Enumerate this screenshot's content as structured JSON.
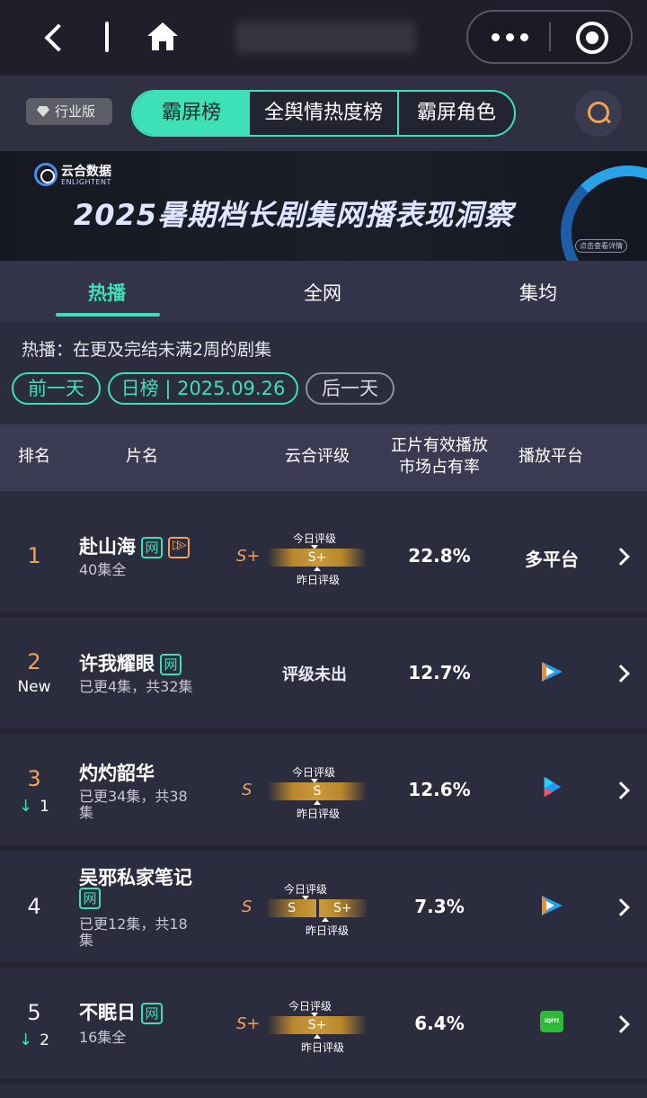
{
  "header": {
    "edition_label": "行业版",
    "segments": [
      "霸屏榜",
      "全舆情热度榜",
      "霸屏角色"
    ]
  },
  "banner": {
    "brand_cn": "云合数据",
    "brand_en": "ENLIGHTENT",
    "title": "2025暑期档长剧集网播表现洞察",
    "cta": "点击查看详情"
  },
  "subtabs": [
    "热播",
    "全网",
    "集均"
  ],
  "info": {
    "description": "热播：在更及完结未满2周的剧集",
    "prev_day": "前一天",
    "date_label": "日榜 | 2025.09.26",
    "next_day": "后一天"
  },
  "table": {
    "headers": {
      "rank": "排名",
      "title": "片名",
      "grade": "云合评级",
      "share_line1": "正片有效播放",
      "share_line2": "市场占有率",
      "platform": "播放平台"
    },
    "grade_today": "今日评级",
    "grade_yesterday": "昨日评级",
    "rows": [
      {
        "rank": "1",
        "change": "",
        "title": "赴山海",
        "tag": "网",
        "episodes": "40集全",
        "grade": "S+",
        "today": "S+",
        "yesterday": "",
        "share": "22.8%",
        "platform": "多平台"
      },
      {
        "rank": "2",
        "change": "New",
        "title": "许我耀眼",
        "tag": "网",
        "episodes": "已更4集，共32集",
        "grade": "",
        "today": "",
        "yesterday": "",
        "ungraded": "评级未出",
        "share": "12.7%",
        "platform": "tencent-video-icon"
      },
      {
        "rank": "3",
        "change": "1",
        "title": "灼灼韶华",
        "tag": "",
        "episodes_l1": "已更34集，共38",
        "episodes_l2": "集",
        "grade": "S",
        "today": "S",
        "yesterday": "",
        "share": "12.6%",
        "platform": "youku-icon"
      },
      {
        "rank": "4",
        "change": "",
        "title": "吴邪私家笔记",
        "tag": "网",
        "episodes_l1": "已更12集，共18",
        "episodes_l2": "集",
        "grade": "S",
        "today": "S",
        "yesterday": "S+",
        "share": "7.3%",
        "platform": "tencent-video-icon"
      },
      {
        "rank": "5",
        "change": "2",
        "title": "不眠日",
        "tag": "网",
        "episodes": "16集全",
        "grade": "S+",
        "today": "S+",
        "yesterday": "",
        "share": "6.4%",
        "platform": "iqiyi-icon",
        "iqiyi_label": "iQIYI"
      }
    ]
  },
  "colors": {
    "accent": "#3ee0b8",
    "orange": "#f2a25a",
    "background": "#2b2c3d"
  }
}
